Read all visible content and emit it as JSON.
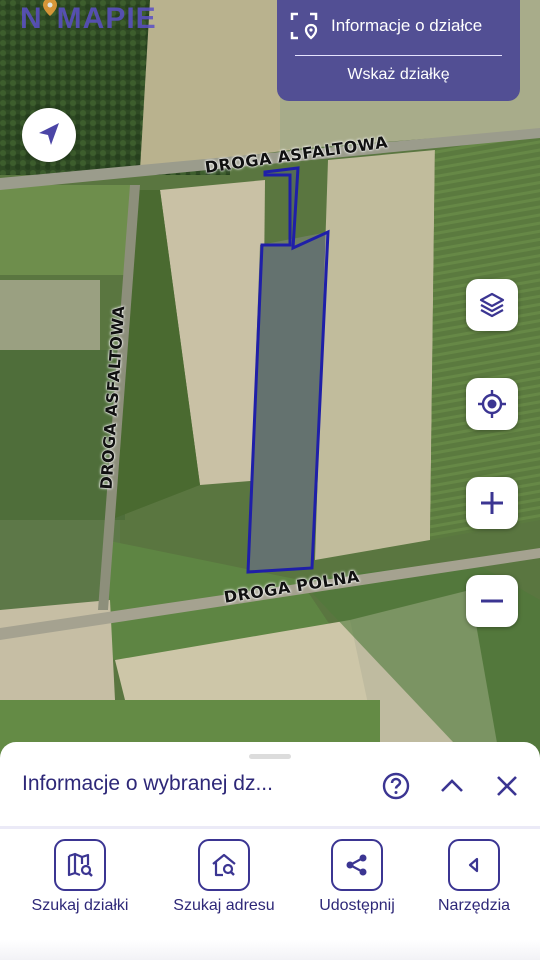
{
  "app": {
    "logo_text": "MAPIE",
    "logo_prefix": "N"
  },
  "info_panel": {
    "title": "Informacje o działce",
    "action": "Wskaż działkę"
  },
  "road_labels": {
    "top": "DROGA ASFALTOWA",
    "left": "DROGA ASFALTOWA",
    "bottom": "DROGA POLNA"
  },
  "map_controls": {
    "layers": "layers-icon",
    "locate": "crosshair-icon",
    "zoom_in": "+",
    "zoom_out": "−"
  },
  "sheet": {
    "title": "Informacje o wybranej dz...",
    "tools": [
      {
        "label": "Szukaj działki",
        "icon": "map-search-icon"
      },
      {
        "label": "Szukaj adresu",
        "icon": "home-search-icon"
      },
      {
        "label": "Udostępnij",
        "icon": "share-icon"
      },
      {
        "label": "Narzędzia",
        "icon": "chevron-left-icon"
      }
    ]
  },
  "colors": {
    "accent": "#3f3a96",
    "parcel_outline": "#1f1fa8",
    "text_dark": "#2e2878"
  }
}
